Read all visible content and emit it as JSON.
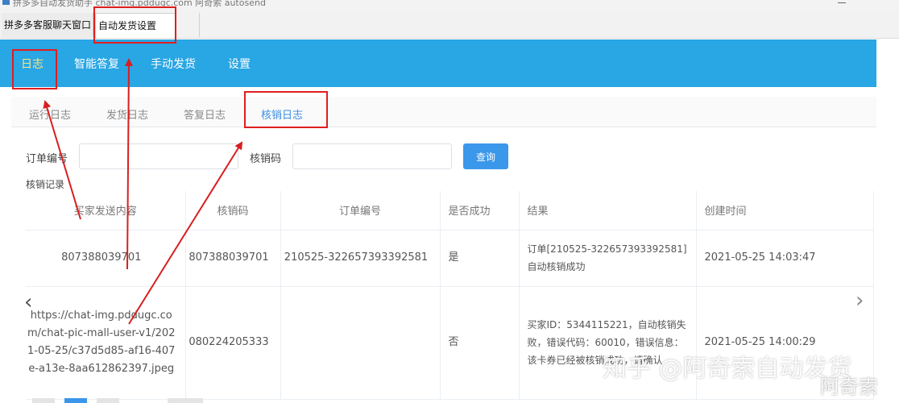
{
  "window": {
    "title": "拼多多自动发货助手 chat-img.pddugc.com 阿奇索 autosend"
  },
  "window_tabs": [
    {
      "label": "拼多多客服聊天窗口"
    },
    {
      "label": "自动发货设置"
    }
  ],
  "top_nav": [
    {
      "label": "日志"
    },
    {
      "label": "智能答复"
    },
    {
      "label": "手动发货"
    },
    {
      "label": "设置"
    }
  ],
  "sub_tabs": [
    {
      "label": "运行日志"
    },
    {
      "label": "发货日志"
    },
    {
      "label": "答复日志"
    },
    {
      "label": "核销日志"
    }
  ],
  "filters": {
    "order_label": "订单编号",
    "order_value": "",
    "code_label": "核销码",
    "code_value": "",
    "query_button": "查询"
  },
  "records": {
    "title": "核销记录",
    "columns": [
      "买家发送内容",
      "核销码",
      "订单编号",
      "是否成功",
      "结果",
      "创建时间"
    ],
    "rows": [
      {
        "content": "807388039701",
        "code": "807388039701",
        "order": "210525-322657393392581",
        "success": "是",
        "result": "订单[210525-322657393392581]自动核销成功",
        "created": "2021-05-25 14:03:47"
      },
      {
        "content": "https://chat-img.pddugc.com/chat-pic-mall-user-v1/2021-05-25/c37d5d85-af16-407e-a13e-8aa612862397.jpeg",
        "code": "080224205333",
        "order": "",
        "success": "否",
        "result": "买家ID：5344115221，自动核销失败，错误代码：60010，错误信息：该卡券已经被核销成功，请确认",
        "created": "2021-05-25 14:00:29"
      }
    ]
  },
  "carousel": {
    "prev": "‹",
    "next": "›"
  },
  "watermark": {
    "main": "知乎 @阿奇索自动发货",
    "sub": "阿奇索"
  },
  "colors": {
    "nav_bg": "#29a6e4",
    "accent": "#3a8ee6",
    "annotation": "#e01e1e",
    "success": "#3aa13a",
    "fail": "#e34040"
  },
  "icons": {
    "window": "app-window-icon",
    "prev": "chevron-left-icon",
    "next": "chevron-right-icon"
  }
}
